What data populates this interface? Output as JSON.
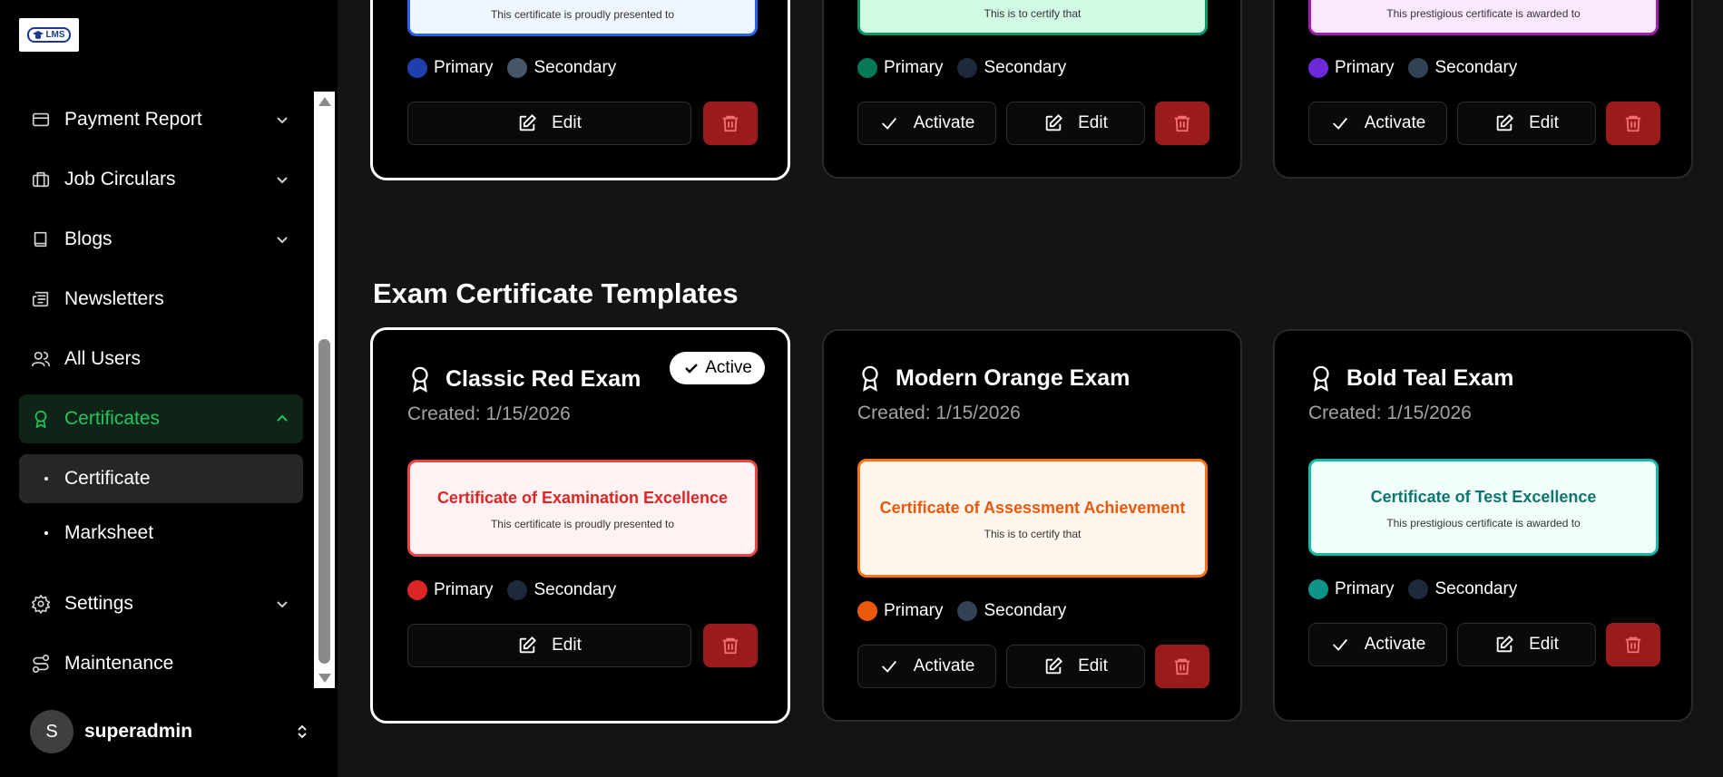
{
  "brand": {
    "logo_text": "LMS"
  },
  "sidebar": {
    "items": [
      {
        "label": "Payment Report",
        "icon": "credit-card-icon",
        "expandable": true
      },
      {
        "label": "Job Circulars",
        "icon": "briefcase-icon",
        "expandable": true
      },
      {
        "label": "Blogs",
        "icon": "book-icon",
        "expandable": true
      },
      {
        "label": "Newsletters",
        "icon": "newspaper-icon",
        "expandable": false
      },
      {
        "label": "All Users",
        "icon": "users-icon",
        "expandable": false
      },
      {
        "label": "Certificates",
        "icon": "award-icon",
        "expandable": true,
        "active": true
      },
      {
        "label": "Settings",
        "icon": "gear-icon",
        "expandable": true
      },
      {
        "label": "Maintenance",
        "icon": "route-icon",
        "expandable": false
      }
    ],
    "sub_items": [
      {
        "label": "Certificate",
        "selected": true
      },
      {
        "label": "Marksheet",
        "selected": false
      }
    ]
  },
  "user": {
    "initial": "S",
    "name": "superadmin"
  },
  "top_row": [
    {
      "preview_sub": "This certificate is proudly presented to",
      "primary_color": "#1e40af",
      "secondary_color": "#475569",
      "preview_border": "#2563eb",
      "preview_bg": "#eff6ff",
      "is_active": true
    },
    {
      "preview_sub": "This is to certify that",
      "primary_color": "#047857",
      "secondary_color": "#1e293b",
      "preview_border": "#059669",
      "preview_bg": "#d1fae5",
      "is_active": false
    },
    {
      "preview_sub": "This prestigious certificate is awarded to",
      "primary_color": "#6d28d9",
      "secondary_color": "#334155",
      "preview_border": "#a21caf",
      "preview_bg": "#fae8ff",
      "is_active": false
    }
  ],
  "section": {
    "title": "Exam Certificate Templates"
  },
  "labels": {
    "primary": "Primary",
    "secondary": "Secondary",
    "edit": "Edit",
    "activate": "Activate",
    "active": "Active"
  },
  "exam_templates": [
    {
      "name": "Classic Red Exam",
      "created": "Created: 1/15/2026",
      "preview_title": "Certificate of Examination Excellence",
      "preview_sub": "This certificate is proudly presented to",
      "title_color": "#dc2626",
      "preview_border": "#ef4444",
      "preview_bg": "#fef2f2",
      "primary_color": "#dc2626",
      "secondary_color": "#1e293b",
      "is_active": true
    },
    {
      "name": "Modern Orange Exam",
      "created": "Created: 1/15/2026",
      "preview_title": "Certificate of Assessment Achievement",
      "preview_sub": "This is to certify that",
      "title_color": "#ea580c",
      "preview_border": "#f97316",
      "preview_bg": "#fff7ed",
      "primary_color": "#ea580c",
      "secondary_color": "#334155",
      "is_active": false
    },
    {
      "name": "Bold Teal Exam",
      "created": "Created: 1/15/2026",
      "preview_title": "Certificate of Test Excellence",
      "preview_sub": "This prestigious certificate is awarded to",
      "title_color": "#0f766e",
      "preview_border": "#14b8a6",
      "preview_bg": "#f0fdfa",
      "primary_color": "#0d9488",
      "secondary_color": "#1e293b",
      "is_active": false
    }
  ]
}
